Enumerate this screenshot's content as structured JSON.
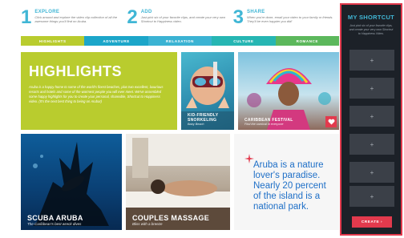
{
  "steps": [
    {
      "num": "1",
      "title": "EXPLORE",
      "desc": "Click around and explore the video clip collection of all the awesome things you'll find on Aruba.",
      "color": "#40b6d5"
    },
    {
      "num": "2",
      "title": "ADD",
      "desc": "Just pick six of your favorite clips, and create your very own Shortcut to Happiness video.",
      "color": "#40b6d5"
    },
    {
      "num": "3",
      "title": "SHARE",
      "desc": "When you're done, email your video to your family or friends. They'll be even happier you did!",
      "color": "#40b6d5"
    }
  ],
  "tabs": [
    {
      "label": "HIGHLIGHTS",
      "color": "#b9cc2e"
    },
    {
      "label": "ADVENTURE",
      "color": "#1ca6c9"
    },
    {
      "label": "RELAXATION",
      "color": "#3bb3d3"
    },
    {
      "label": "CULTURE",
      "color": "#26b6b3"
    },
    {
      "label": "ROMANCE",
      "color": "#5cb85c"
    }
  ],
  "highlights": {
    "title": "HIGHLIGHTS",
    "text": "Aruba is a happy home to some of the world's finest beaches, plus two excellent, luxurious resorts and hotels and some of the warmest people you will ever meet. We've assembled some happy highlights for you to create your personal, shareable, Shortcut to Happiness video. (It's the next best thing to being on Aruba!)"
  },
  "tiles": {
    "snorkel": {
      "title": "KID-FRIENDLY SNORKELING",
      "sub": "Baby Beach"
    },
    "carnival": {
      "title": "CARIBBEAN FESTIVAL",
      "sub": "Find the carnival in everyone"
    },
    "scuba": {
      "title": "SCUBA ARUBA",
      "sub": "The Caribbean's best wreck dives"
    },
    "massage": {
      "title": "COUPLES MASSAGE",
      "sub": "Bliss with a breeze"
    }
  },
  "quote": {
    "text": "Aruba is a nature lover's paradise. Nearly 20 percent of the island is a national park."
  },
  "sidebar": {
    "title": "MY SHORTCUT",
    "desc": "Just pick six of your favorite clips, and create your very own Shortcut to Happiness Video.",
    "slot_icon": "+",
    "create_label": "CREATE ›"
  },
  "colors": {
    "accent_red": "#e23a4d",
    "brand_blue": "#40b6d5",
    "lime": "#b9cc2e"
  }
}
